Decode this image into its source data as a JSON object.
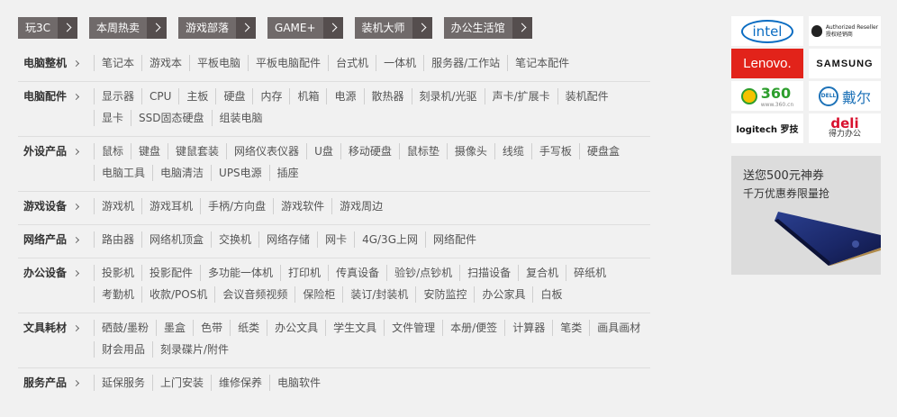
{
  "tabs": [
    {
      "label": "玩3C"
    },
    {
      "label": "本周热卖"
    },
    {
      "label": "游戏部落"
    },
    {
      "label": "GAME+"
    },
    {
      "label": "装机大师"
    },
    {
      "label": "办公生活馆"
    }
  ],
  "categories": [
    {
      "title": "电脑整机",
      "items": [
        "笔记本",
        "游戏本",
        "平板电脑",
        "平板电脑配件",
        "台式机",
        "一体机",
        "服务器/工作站",
        "笔记本配件"
      ]
    },
    {
      "title": "电脑配件",
      "items": [
        "显示器",
        "CPU",
        "主板",
        "硬盘",
        "内存",
        "机箱",
        "电源",
        "散热器",
        "刻录机/光驱",
        "声卡/扩展卡",
        "装机配件",
        "显卡",
        "SSD固态硬盘",
        "组装电脑"
      ]
    },
    {
      "title": "外设产品",
      "items": [
        "鼠标",
        "键盘",
        "键鼠套装",
        "网络仪表仪器",
        "U盘",
        "移动硬盘",
        "鼠标垫",
        "摄像头",
        "线缆",
        "手写板",
        "硬盘盒",
        "电脑工具",
        "电脑清洁",
        "UPS电源",
        "插座"
      ]
    },
    {
      "title": "游戏设备",
      "items": [
        "游戏机",
        "游戏耳机",
        "手柄/方向盘",
        "游戏软件",
        "游戏周边"
      ]
    },
    {
      "title": "网络产品",
      "items": [
        "路由器",
        "网络机顶盒",
        "交换机",
        "网络存储",
        "网卡",
        "4G/3G上网",
        "网络配件"
      ]
    },
    {
      "title": "办公设备",
      "items": [
        "投影机",
        "投影配件",
        "多功能一体机",
        "打印机",
        "传真设备",
        "验钞/点钞机",
        "扫描设备",
        "复合机",
        "碎纸机",
        "考勤机",
        "收款/POS机",
        "会议音频视频",
        "保险柜",
        "装订/封装机",
        "安防监控",
        "办公家具",
        "白板"
      ]
    },
    {
      "title": "文具耗材",
      "items": [
        "硒鼓/墨粉",
        "墨盒",
        "色带",
        "纸类",
        "办公文具",
        "学生文具",
        "文件管理",
        "本册/便签",
        "计算器",
        "笔类",
        "画具画材",
        "财会用品",
        "刻录碟片/附件"
      ]
    },
    {
      "title": "服务产品",
      "items": [
        "延保服务",
        "上门安装",
        "维修保养",
        "电脑软件"
      ]
    }
  ],
  "brands": {
    "intel": "intel",
    "apple_line1": "Authorized Reseller",
    "apple_line2": "授权经销商",
    "lenovo": "Lenovo.",
    "samsung": "SAMSUNG",
    "b360": "360",
    "b360_url": "www.360.cn",
    "dell_logo": "DELL",
    "dell_cn": "戴尔",
    "logitech": "logitech 罗技",
    "deli": "deli",
    "deli_cn": "得力办公"
  },
  "promo": {
    "title": "送您500元神券",
    "subtitle": "千万优惠券限量抢"
  }
}
